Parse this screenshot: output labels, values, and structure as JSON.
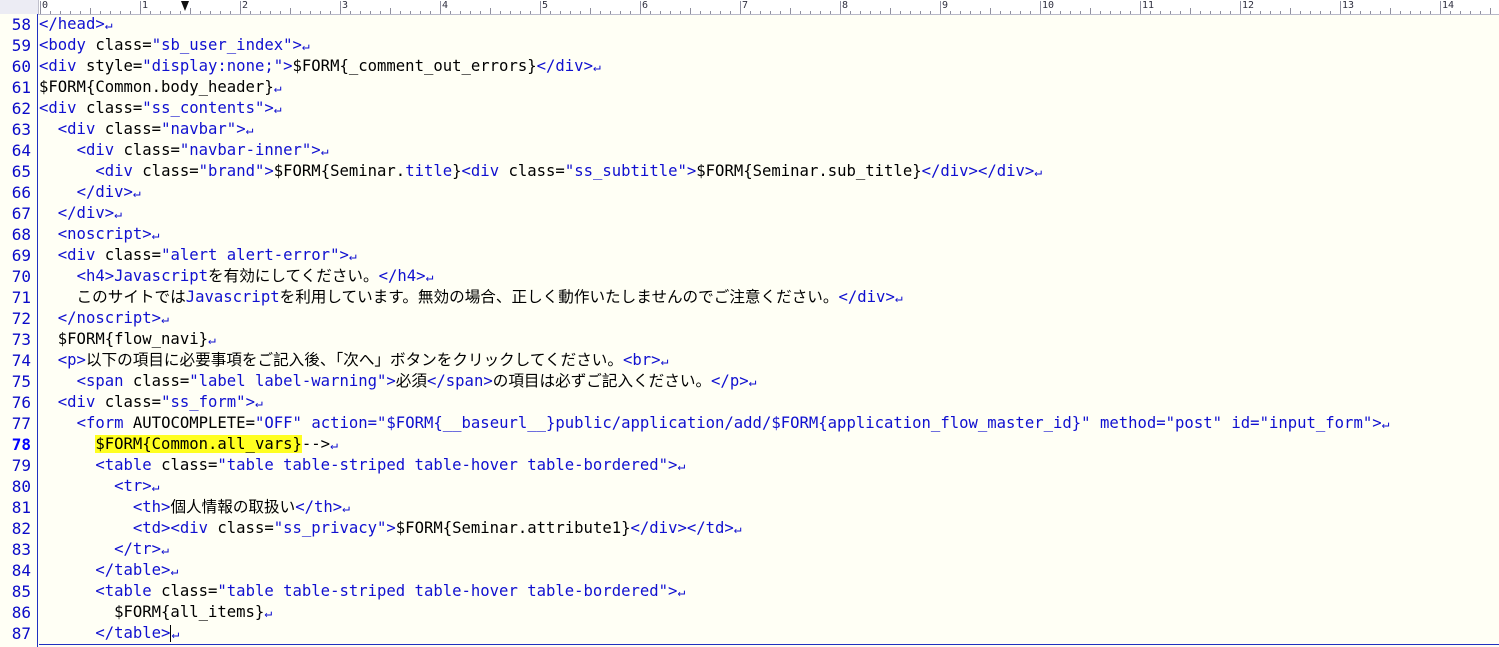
{
  "ruler": {
    "labels": [
      "0",
      "1",
      "2",
      "3",
      "4",
      "5",
      "6",
      "7",
      "8",
      "9",
      "10",
      "11",
      "12",
      "13",
      "14"
    ]
  },
  "editor": {
    "current_line": "78",
    "eol_mark": "↵",
    "lines": [
      {
        "num": "58",
        "segs": [
          [
            "t",
            "</head>"
          ]
        ]
      },
      {
        "num": "59",
        "segs": [
          [
            "t",
            "<body "
          ],
          [
            "p",
            "class="
          ],
          [
            "s",
            "\"sb_user_index\""
          ],
          [
            "t",
            ">"
          ]
        ]
      },
      {
        "num": "60",
        "segs": [
          [
            "t",
            "<div "
          ],
          [
            "p",
            "style="
          ],
          [
            "s",
            "\"display:none;\""
          ],
          [
            "t",
            ">"
          ],
          [
            "p",
            "$FORM{_comment_out_errors}"
          ],
          [
            "t",
            "</div>"
          ]
        ]
      },
      {
        "num": "61",
        "segs": [
          [
            "p",
            "$FORM{Common.body_header}"
          ]
        ]
      },
      {
        "num": "62",
        "segs": [
          [
            "t",
            "<div "
          ],
          [
            "p",
            "class="
          ],
          [
            "s",
            "\"ss_contents\""
          ],
          [
            "t",
            ">"
          ]
        ]
      },
      {
        "num": "63",
        "segs": [
          [
            "p",
            "  "
          ],
          [
            "t",
            "<div "
          ],
          [
            "p",
            "class="
          ],
          [
            "s",
            "\"navbar\""
          ],
          [
            "t",
            ">"
          ]
        ]
      },
      {
        "num": "64",
        "segs": [
          [
            "p",
            "    "
          ],
          [
            "t",
            "<div "
          ],
          [
            "p",
            "class="
          ],
          [
            "s",
            "\"navbar-inner\""
          ],
          [
            "t",
            ">"
          ]
        ]
      },
      {
        "num": "65",
        "segs": [
          [
            "p",
            "      "
          ],
          [
            "t",
            "<div "
          ],
          [
            "p",
            "class="
          ],
          [
            "s",
            "\"brand\""
          ],
          [
            "t",
            ">"
          ],
          [
            "p",
            "$FORM{Seminar."
          ],
          [
            "j",
            "title"
          ],
          [
            "p",
            "}"
          ],
          [
            "t",
            "<div "
          ],
          [
            "p",
            "class="
          ],
          [
            "s",
            "\"ss_subtitle\""
          ],
          [
            "t",
            ">"
          ],
          [
            "p",
            "$FORM{Seminar.sub_title}"
          ],
          [
            "t",
            "</div></div>"
          ]
        ]
      },
      {
        "num": "66",
        "segs": [
          [
            "p",
            "    "
          ],
          [
            "t",
            "</div>"
          ]
        ]
      },
      {
        "num": "67",
        "segs": [
          [
            "p",
            "  "
          ],
          [
            "t",
            "</div>"
          ]
        ]
      },
      {
        "num": "68",
        "segs": [
          [
            "p",
            "  "
          ],
          [
            "t",
            "<noscript>"
          ]
        ]
      },
      {
        "num": "69",
        "segs": [
          [
            "p",
            "  "
          ],
          [
            "t",
            "<div "
          ],
          [
            "p",
            "class="
          ],
          [
            "s",
            "\"alert alert-error\""
          ],
          [
            "t",
            ">"
          ]
        ]
      },
      {
        "num": "70",
        "segs": [
          [
            "p",
            "    "
          ],
          [
            "t",
            "<h4>"
          ],
          [
            "j",
            "Javascript"
          ],
          [
            "p",
            "を有効にしてください。"
          ],
          [
            "t",
            "</h4>"
          ]
        ]
      },
      {
        "num": "71",
        "segs": [
          [
            "p",
            "    このサイトでは"
          ],
          [
            "j",
            "Javascript"
          ],
          [
            "p",
            "を利用しています。無効の場合、正しく動作いたしませんのでご注意ください。"
          ],
          [
            "t",
            "</div>"
          ]
        ]
      },
      {
        "num": "72",
        "segs": [
          [
            "p",
            "  "
          ],
          [
            "t",
            "</noscript>"
          ]
        ]
      },
      {
        "num": "73",
        "segs": [
          [
            "p",
            "  $FORM{flow_navi}"
          ]
        ]
      },
      {
        "num": "74",
        "segs": [
          [
            "p",
            "  "
          ],
          [
            "t",
            "<p>"
          ],
          [
            "p",
            "以下の項目に必要事項をご記入後、「次へ」ボタンをクリックしてください。"
          ],
          [
            "t",
            "<br>"
          ]
        ]
      },
      {
        "num": "75",
        "segs": [
          [
            "p",
            "    "
          ],
          [
            "t",
            "<span "
          ],
          [
            "p",
            "class="
          ],
          [
            "s",
            "\"label label-warning\""
          ],
          [
            "t",
            ">"
          ],
          [
            "p",
            "必須"
          ],
          [
            "t",
            "</span>"
          ],
          [
            "p",
            "の項目は必ずご記入ください。"
          ],
          [
            "t",
            "</p>"
          ]
        ]
      },
      {
        "num": "76",
        "segs": [
          [
            "p",
            "  "
          ],
          [
            "t",
            "<div "
          ],
          [
            "p",
            "class="
          ],
          [
            "s",
            "\"ss_form\""
          ],
          [
            "t",
            ">"
          ]
        ]
      },
      {
        "num": "77",
        "segs": [
          [
            "p",
            "    "
          ],
          [
            "t",
            "<form "
          ],
          [
            "p",
            "AUTOCOMPLETE="
          ],
          [
            "s",
            "\"OFF\""
          ],
          [
            "p",
            " "
          ],
          [
            "t",
            "action="
          ],
          [
            "s",
            "\"$FORM{__baseurl__}public/application/add/$FORM{application_flow_master_id}\""
          ],
          [
            "p",
            " "
          ],
          [
            "t",
            "method="
          ],
          [
            "s",
            "\"post\""
          ],
          [
            "p",
            " "
          ],
          [
            "t",
            "id="
          ],
          [
            "s",
            "\"input_form\""
          ],
          [
            "t",
            ">"
          ]
        ]
      },
      {
        "num": "78",
        "segs": [
          [
            "p",
            "      "
          ],
          [
            "h",
            "$FORM{Common.all_vars}"
          ],
          [
            "p",
            "-->"
          ]
        ]
      },
      {
        "num": "79",
        "segs": [
          [
            "p",
            "      "
          ],
          [
            "t",
            "<table "
          ],
          [
            "p",
            "class="
          ],
          [
            "s",
            "\"table table-striped table-hover table-bordered\""
          ],
          [
            "t",
            ">"
          ]
        ]
      },
      {
        "num": "80",
        "segs": [
          [
            "p",
            "        "
          ],
          [
            "t",
            "<tr>"
          ]
        ]
      },
      {
        "num": "81",
        "segs": [
          [
            "p",
            "          "
          ],
          [
            "t",
            "<th>"
          ],
          [
            "p",
            "個人情報の取扱い"
          ],
          [
            "t",
            "</th>"
          ]
        ]
      },
      {
        "num": "82",
        "segs": [
          [
            "p",
            "          "
          ],
          [
            "t",
            "<td><div "
          ],
          [
            "p",
            "class="
          ],
          [
            "s",
            "\"ss_privacy\""
          ],
          [
            "t",
            ">"
          ],
          [
            "p",
            "$FORM{Seminar.attribute1}"
          ],
          [
            "t",
            "</div></td>"
          ]
        ]
      },
      {
        "num": "83",
        "segs": [
          [
            "p",
            "        "
          ],
          [
            "t",
            "</tr>"
          ]
        ]
      },
      {
        "num": "84",
        "segs": [
          [
            "p",
            "      "
          ],
          [
            "t",
            "</table>"
          ]
        ]
      },
      {
        "num": "85",
        "segs": [
          [
            "p",
            "      "
          ],
          [
            "t",
            "<table "
          ],
          [
            "p",
            "class="
          ],
          [
            "s",
            "\"table table-striped table-hover table-bordered\""
          ],
          [
            "t",
            ">"
          ]
        ]
      },
      {
        "num": "86",
        "segs": [
          [
            "p",
            "        $FORM{all_items}"
          ]
        ]
      },
      {
        "num": "87",
        "segs": [
          [
            "p",
            "      "
          ],
          [
            "t",
            "</table>"
          ],
          [
            "c",
            ""
          ]
        ]
      }
    ]
  }
}
